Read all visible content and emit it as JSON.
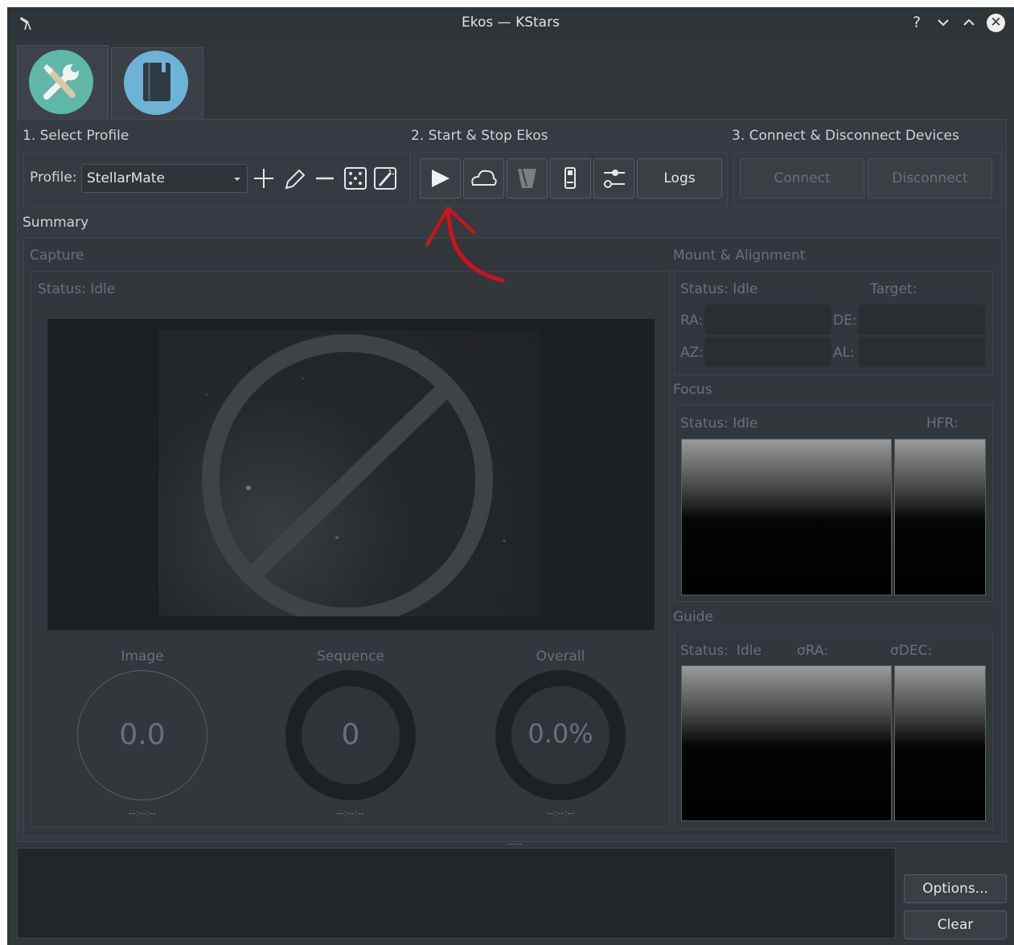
{
  "window": {
    "title": "Ekos — KStars"
  },
  "titlebar": {
    "help": "?",
    "minimize": "⌄",
    "maximize": "⌃",
    "close": "✕"
  },
  "sections": {
    "select_profile": "1. Select Profile",
    "start_stop": "2. Start & Stop Ekos",
    "connect_devices": "3. Connect & Disconnect Devices"
  },
  "profile": {
    "label": "Profile:",
    "value": "StellarMate"
  },
  "buttons": {
    "logs": "Logs",
    "connect": "Connect",
    "disconnect": "Disconnect",
    "options": "Options...",
    "clear": "Clear"
  },
  "summary": {
    "label": "Summary",
    "capture": {
      "title": "Capture",
      "status": "Status: Idle",
      "image": {
        "label": "Image",
        "value": "0.0",
        "time": "--:--:--"
      },
      "sequence": {
        "label": "Sequence",
        "value": "0",
        "time": "--:--:--"
      },
      "overall": {
        "label": "Overall",
        "value": "0.0%",
        "time": "--:--:--"
      }
    },
    "mount": {
      "title": "Mount & Alignment",
      "status": "Status: Idle",
      "target": "Target:",
      "ra": "RA:",
      "de": "DE:",
      "az": "AZ:",
      "al": "AL:"
    },
    "focus": {
      "title": "Focus",
      "status": "Status: Idle",
      "hfr": "HFR:"
    },
    "guide": {
      "title": "Guide",
      "status_label": "Status:",
      "status_value": "Idle",
      "sigma_ra": "σRA:",
      "sigma_dec": "σDEC:"
    }
  },
  "splitter": "......",
  "colors": {
    "window_bg": "#31363b",
    "annotation_arrow": "#d0121b",
    "tab_icon_setup": "#5fb7a8",
    "tab_icon_notes": "#6db3d6"
  }
}
